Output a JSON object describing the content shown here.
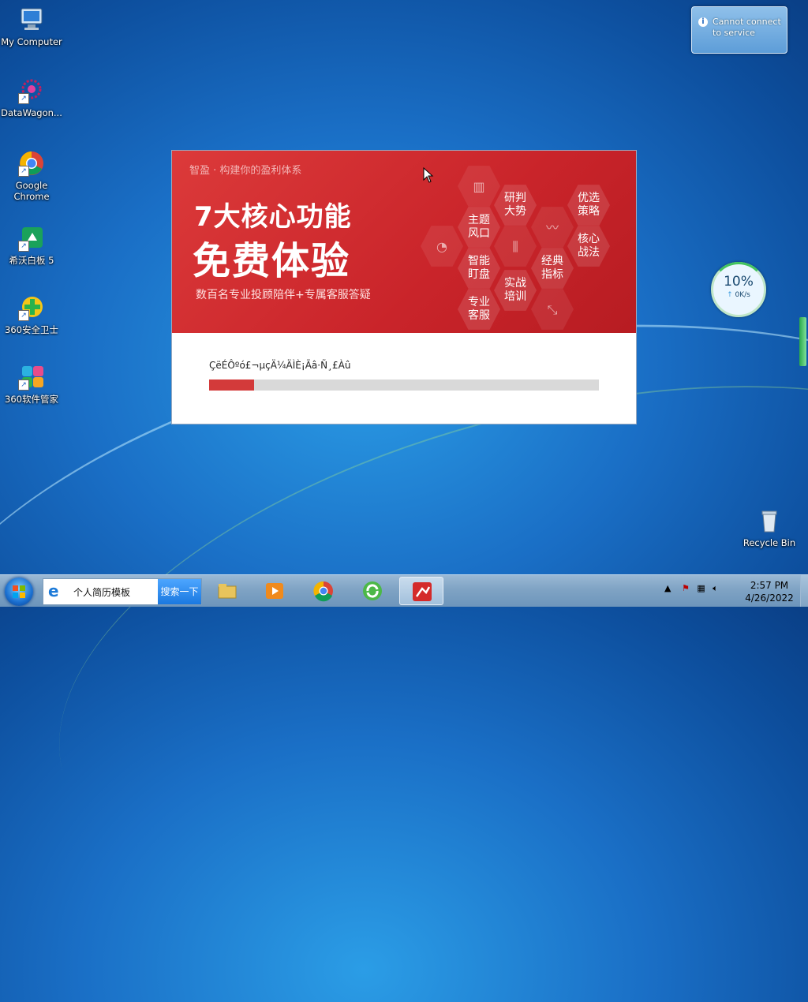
{
  "desktop": {
    "icons": [
      {
        "label": "My Computer"
      },
      {
        "label": "DataWagon..."
      },
      {
        "label": "Google Chrome"
      },
      {
        "label": "希沃白板 5"
      },
      {
        "label": "360安全卫士"
      },
      {
        "label": "360软件管家"
      },
      {
        "label": "Recycle Bin"
      }
    ]
  },
  "notification": {
    "text": "Cannot connect to service"
  },
  "installer": {
    "slogan": "智盈 · 构建你的盈利体系",
    "headline1": "7大核心功能",
    "headline2": "免费体验",
    "subline": "数百名专业投顾陪伴+专属客服答疑",
    "hexes": [
      "研判\n大势",
      "优选\n策略",
      "主题\n风口",
      "核心\n战法",
      "智能\n盯盘",
      "经典\n指标",
      "实战\n培训",
      "专业\n客服"
    ],
    "status_text": "ÇëÉÔºó£¬µçÄ¼ÄÌÈ¡Ãâ·Ñ¸£Àû",
    "progress_fraction": 0.115
  },
  "speed_widget": {
    "percent": "10%",
    "rate": "0K/s"
  },
  "taskbar": {
    "search_value": "个人简历模板",
    "search_button": "搜索一下",
    "clock_time": "2:57 PM",
    "clock_date": "4/26/2022"
  },
  "colors": {
    "accent_red": "#d33a3a",
    "banner_red": "#c9242a"
  }
}
